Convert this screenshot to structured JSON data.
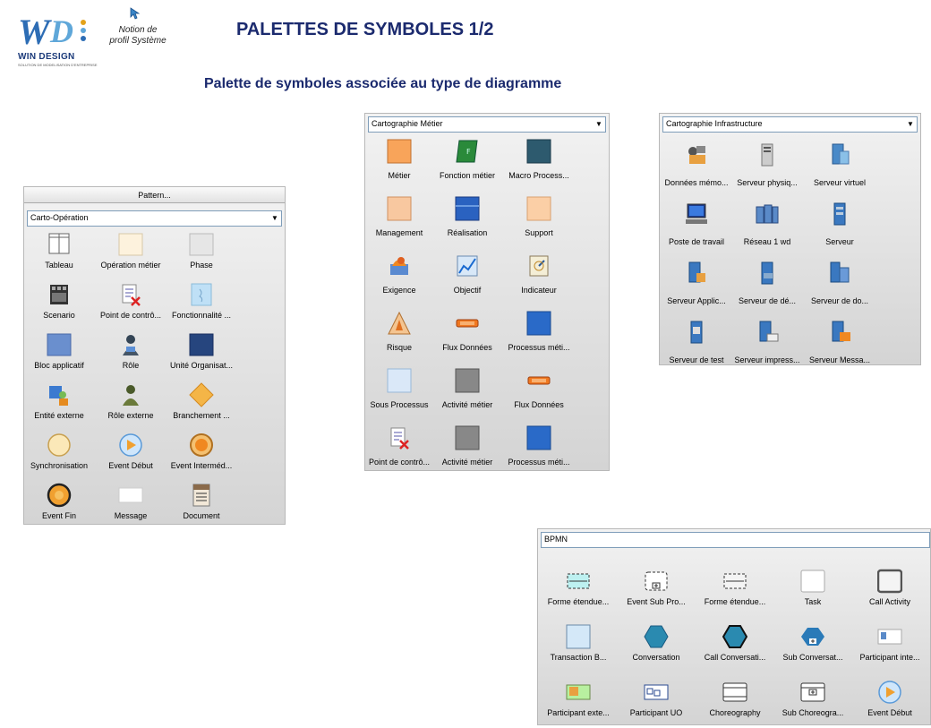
{
  "header": {
    "logo_name": "WIN DESIGN",
    "logo_sub": "SOLUTION DE MODELISATION D'ENTREPRISE",
    "notion_line1": "Notion de",
    "notion_line2": "profil Système",
    "title": "PALETTES DE SYMBOLES 1/2",
    "subtitle": "Palette de symboles associée au type de diagramme"
  },
  "colors": {
    "title": "#1b2a6e",
    "logo_blue": "#2d6db5",
    "logo_light": "#5fa7d9",
    "panel_bg": "#dcdcdc"
  },
  "panels": {
    "carto_operation": {
      "header": "Pattern...",
      "combo": "Carto-Opération",
      "items": [
        {
          "label": "Tableau",
          "icon": "table-icon"
        },
        {
          "label": "Opération métier",
          "icon": "operation-icon"
        },
        {
          "label": "Phase",
          "icon": "phase-icon"
        },
        {
          "label": "Scenario",
          "icon": "scenario-icon"
        },
        {
          "label": "Point de contrô...",
          "icon": "checkpoint-icon"
        },
        {
          "label": "Fonctionnalité ...",
          "icon": "feature-icon"
        },
        {
          "label": "Bloc applicatif",
          "icon": "app-block-icon"
        },
        {
          "label": "Rôle",
          "icon": "role-icon"
        },
        {
          "label": "Unité Organisat...",
          "icon": "org-unit-icon"
        },
        {
          "label": "Entité externe",
          "icon": "external-entity-icon"
        },
        {
          "label": "Rôle externe",
          "icon": "external-role-icon"
        },
        {
          "label": "Branchement ...",
          "icon": "branch-icon"
        },
        {
          "label": "Synchronisation",
          "icon": "sync-icon"
        },
        {
          "label": "Event Début",
          "icon": "event-start-icon"
        },
        {
          "label": "Event Interméd...",
          "icon": "event-intermediate-icon"
        },
        {
          "label": "Event Fin",
          "icon": "event-end-icon"
        },
        {
          "label": "Message",
          "icon": "message-icon"
        },
        {
          "label": "Document",
          "icon": "document-icon"
        }
      ]
    },
    "carto_metier": {
      "combo": "Cartographie Métier",
      "items": [
        {
          "label": "Métier",
          "icon": "metier-icon"
        },
        {
          "label": "Fonction métier",
          "icon": "business-function-icon"
        },
        {
          "label": "Macro Process...",
          "icon": "macro-process-icon"
        },
        {
          "label": "Management",
          "icon": "management-icon"
        },
        {
          "label": "Réalisation",
          "icon": "realisation-icon"
        },
        {
          "label": "Support",
          "icon": "support-icon"
        },
        {
          "label": "Exigence",
          "icon": "requirement-icon"
        },
        {
          "label": "Objectif",
          "icon": "objective-icon"
        },
        {
          "label": "Indicateur",
          "icon": "indicator-icon"
        },
        {
          "label": "Risque",
          "icon": "risk-icon"
        },
        {
          "label": "Flux Données",
          "icon": "data-flow-icon"
        },
        {
          "label": "Processus méti...",
          "icon": "business-process-icon"
        },
        {
          "label": "Sous Processus",
          "icon": "sub-process-icon"
        },
        {
          "label": "Activité métier",
          "icon": "business-activity-icon"
        },
        {
          "label": "Flux Données",
          "icon": "data-flow-icon"
        },
        {
          "label": "Point de contrô...",
          "icon": "checkpoint-icon"
        },
        {
          "label": "Activité métier",
          "icon": "business-activity-icon"
        },
        {
          "label": "Processus méti...",
          "icon": "business-process-icon"
        }
      ]
    },
    "carto_infra": {
      "combo": "Cartographie Infrastructure",
      "items": [
        {
          "label": "Données mémo...",
          "icon": "memory-data-icon"
        },
        {
          "label": "Serveur physiq...",
          "icon": "physical-server-icon"
        },
        {
          "label": "Serveur virtuel",
          "icon": "virtual-server-icon"
        },
        {
          "label": "Poste de travail",
          "icon": "workstation-icon"
        },
        {
          "label": "Réseau 1 wd",
          "icon": "network-icon"
        },
        {
          "label": "Serveur",
          "icon": "server-icon"
        },
        {
          "label": "Serveur Applic...",
          "icon": "app-server-icon"
        },
        {
          "label": "Serveur de dé...",
          "icon": "deploy-server-icon"
        },
        {
          "label": "Serveur de do...",
          "icon": "data-server-icon"
        },
        {
          "label": "Serveur de test",
          "icon": "test-server-icon"
        },
        {
          "label": "Serveur impress...",
          "icon": "print-server-icon"
        },
        {
          "label": "Serveur Messa...",
          "icon": "message-server-icon"
        }
      ]
    },
    "bpmn": {
      "combo": "BPMN",
      "items": [
        {
          "label": "Forme étendue...",
          "icon": "extended-shape-icon"
        },
        {
          "label": "Event Sub Pro...",
          "icon": "event-subprocess-icon"
        },
        {
          "label": "Forme étendue...",
          "icon": "extended-shape-dashed-icon"
        },
        {
          "label": "Task",
          "icon": "task-icon"
        },
        {
          "label": "Call Activity",
          "icon": "call-activity-icon"
        },
        {
          "label": "Transaction B...",
          "icon": "transaction-icon"
        },
        {
          "label": "Conversation",
          "icon": "conversation-icon"
        },
        {
          "label": "Call Conversati...",
          "icon": "call-conversation-icon"
        },
        {
          "label": "Sub Conversat...",
          "icon": "sub-conversation-icon"
        },
        {
          "label": "Participant inte...",
          "icon": "internal-participant-icon"
        },
        {
          "label": "Participant exte...",
          "icon": "external-participant-icon"
        },
        {
          "label": "Participant UO",
          "icon": "participant-uo-icon"
        },
        {
          "label": "Choreography",
          "icon": "choreography-icon"
        },
        {
          "label": "Sub Choreogra...",
          "icon": "sub-choreography-icon"
        },
        {
          "label": "Event Début",
          "icon": "event-start-icon"
        }
      ]
    }
  }
}
